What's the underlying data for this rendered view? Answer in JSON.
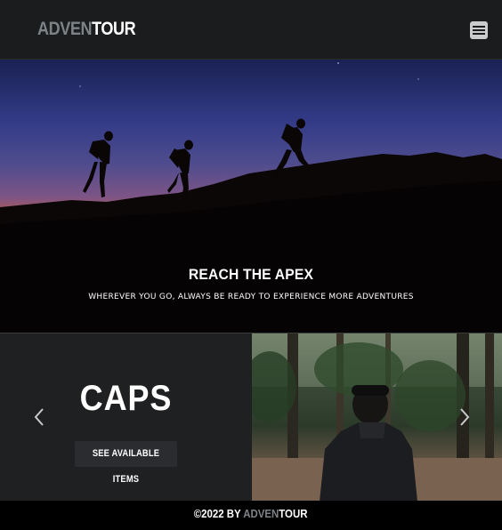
{
  "navbar": {
    "brand_part1": "ADVEN",
    "brand_part2": "TOUR",
    "menu_icon": "hamburger-menu-icon"
  },
  "hero": {
    "title": "REACH THE APEX",
    "subtitle": "WHEREVER YOU GO, ALWAYS BE READY TO EXPERIENCE MORE ADVENTURES"
  },
  "carousel": {
    "slide_title": "CAPS",
    "button_label": "SEE AVAILABLE ITEMS",
    "prev_icon": "chevron-left-icon",
    "next_icon": "chevron-right-icon"
  },
  "footer": {
    "prefix": "©2022 BY ",
    "brand_part1": "ADVEN",
    "brand_part2": "TOUR"
  },
  "colors": {
    "navbar_bg": "#1b1c1e",
    "brand_gray": "#7d8287",
    "carousel_bg": "#1f2021",
    "button_bg": "#2a2c30",
    "footer_bg": "#000000"
  }
}
